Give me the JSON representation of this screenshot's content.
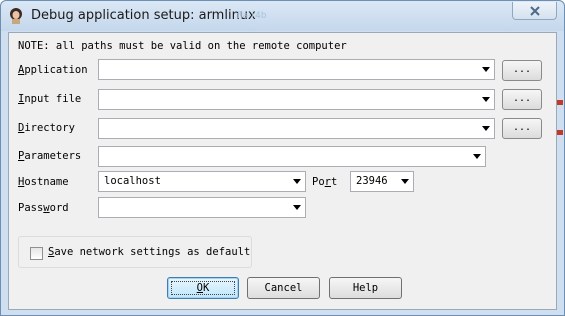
{
  "window": {
    "title": "Debug application setup: armlinux",
    "title_faded": "fla-r4b",
    "close_label": "Close"
  },
  "note": "NOTE: all paths must be valid on the remote computer",
  "fields": {
    "application": {
      "label_key": "A",
      "label_rest": "pplication",
      "value": "",
      "browse": "..."
    },
    "input_file": {
      "label_key": "I",
      "label_rest": "nput file",
      "value": "",
      "browse": "..."
    },
    "directory": {
      "label_key": "D",
      "label_rest": "irectory",
      "value": "",
      "browse": "..."
    },
    "parameters": {
      "label_key": "P",
      "label_rest": "arameters",
      "value": ""
    },
    "hostname": {
      "label_key": "H",
      "label_rest": "ostname",
      "value": "localhost"
    },
    "port": {
      "label_pre": "Po",
      "label_key": "r",
      "label_rest": "t",
      "value": "23946"
    },
    "password": {
      "label_pre": "Pass",
      "label_key": "w",
      "label_rest": "ord",
      "value": ""
    }
  },
  "save_checkbox": {
    "label_key": "S",
    "label_rest": "ave network settings as default",
    "checked": false
  },
  "buttons": {
    "ok_key": "O",
    "ok_rest": "K",
    "cancel": "Cancel",
    "help": "Help"
  },
  "colors": {
    "title_bg": "#c4d7ec",
    "client_bg": "#f0f0f0",
    "default_button_border": "#3c7fb1"
  }
}
